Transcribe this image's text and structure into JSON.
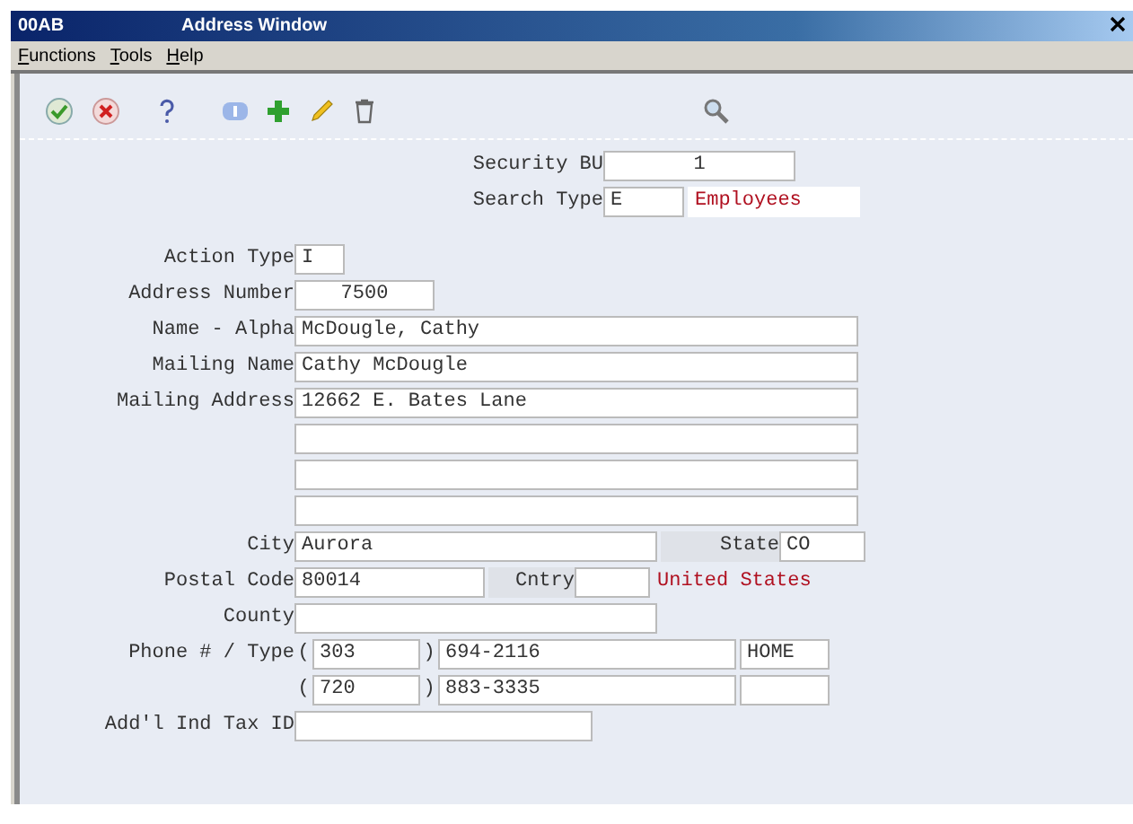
{
  "window": {
    "app": "00AB",
    "title": "Address Window"
  },
  "menu": [
    {
      "label": "Functions"
    },
    {
      "label": "Tools"
    },
    {
      "label": "Help"
    }
  ],
  "toolbar": [
    {
      "kind": "ok"
    },
    {
      "kind": "cancel"
    },
    {
      "kind": "help"
    },
    {
      "kind": "info"
    },
    {
      "kind": "add"
    },
    {
      "kind": "edit"
    },
    {
      "kind": "delete"
    },
    {
      "kind": "find"
    }
  ],
  "header": {
    "security_bu": {
      "label": "Security BU",
      "value": "1"
    },
    "search_type": {
      "label": "Search Type",
      "value": "E",
      "description": "Employees"
    }
  },
  "form": {
    "action_type": {
      "label": "Action Type",
      "value": "I"
    },
    "address_number": {
      "label": "Address Number",
      "value": "7500"
    },
    "name_alpha": {
      "label": "Name - Alpha",
      "value": "McDougle, Cathy"
    },
    "mailing_name": {
      "label": "Mailing Name",
      "value": "Cathy McDougle"
    },
    "mailing_address": {
      "label": "Mailing Address",
      "lines": [
        {
          "value": "12662 E. Bates Lane"
        }
      ]
    },
    "city": {
      "label": "City",
      "value": "Aurora"
    },
    "state": {
      "label": "State",
      "value": "CO"
    },
    "postal_code": {
      "label": "Postal Code",
      "value": "80014"
    },
    "country": {
      "label": "Cntry",
      "description": "United States"
    },
    "county": {
      "label": "County"
    },
    "phone": {
      "label": "Phone # / Type",
      "open": "(",
      "close": ")",
      "rows": [
        {
          "area": "303",
          "number": "694-2116",
          "type": "HOME"
        },
        {
          "area": "720",
          "number": "883-3335"
        }
      ]
    },
    "tax_id": {
      "label": "Add'l Ind Tax ID"
    }
  }
}
